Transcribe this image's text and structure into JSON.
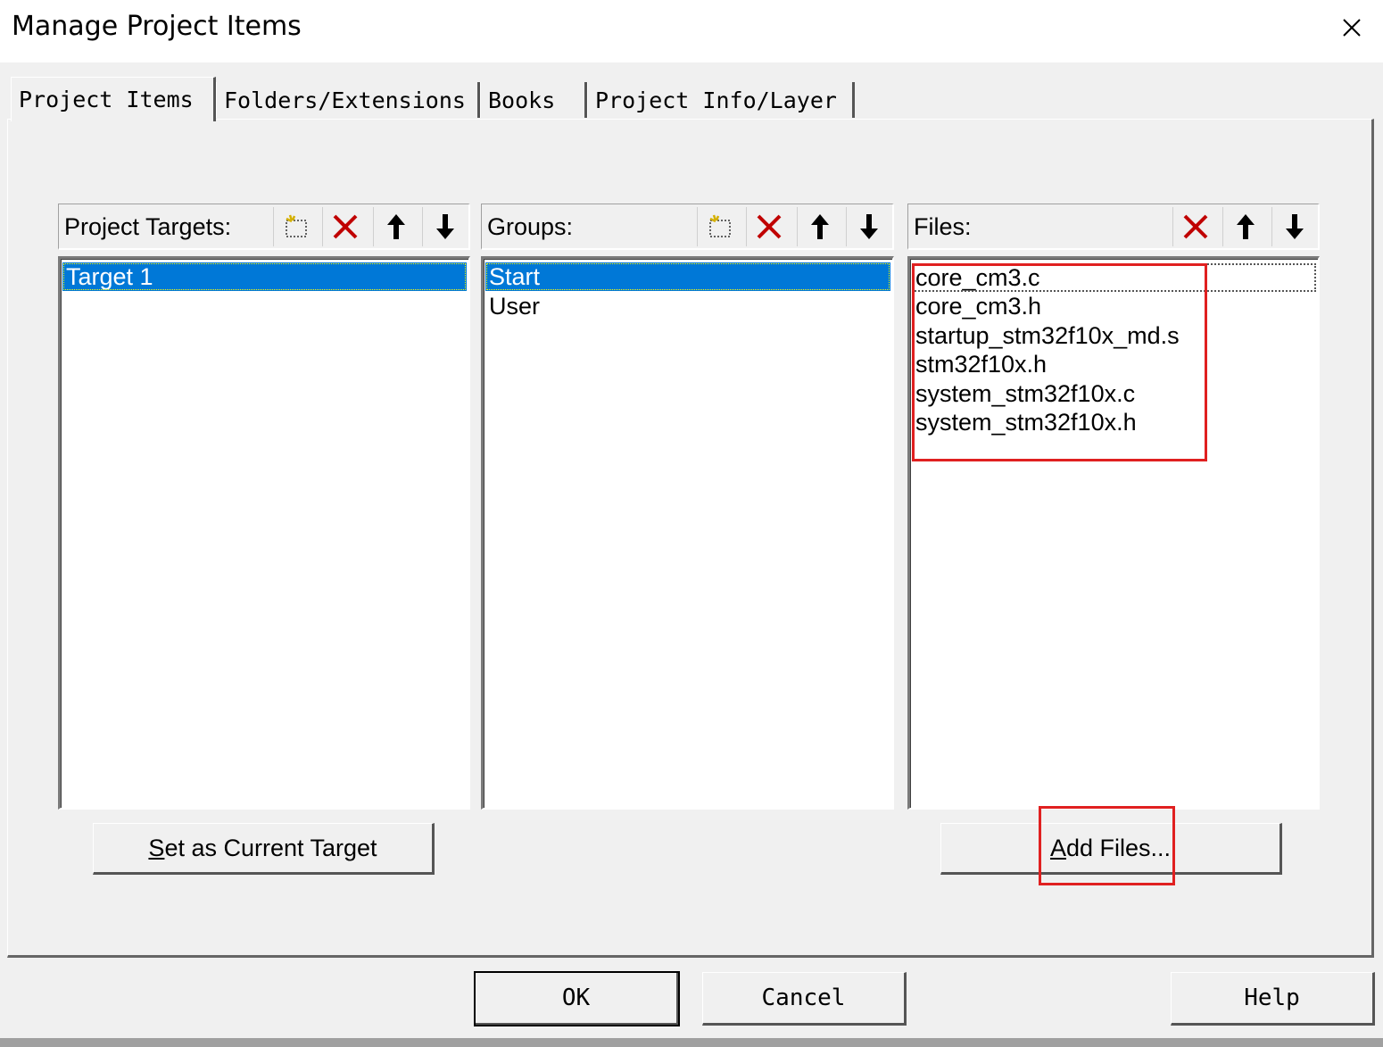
{
  "window": {
    "title": "Manage Project Items",
    "close_icon": "close-icon"
  },
  "tabs": [
    {
      "label": "Project Items"
    },
    {
      "label": "Folders/Extensions"
    },
    {
      "label": "Books"
    },
    {
      "label": "Project Info/Layer"
    }
  ],
  "targets": {
    "label": "Project Targets:",
    "items": [
      "Target 1"
    ],
    "set_current_pre": "",
    "set_current_accel": "S",
    "set_current_post": "et as Current Target"
  },
  "groups": {
    "label": "Groups:",
    "items": [
      "Start",
      "User"
    ]
  },
  "files": {
    "label": "Files:",
    "items": [
      "core_cm3.c",
      "core_cm3.h",
      "startup_stm32f10x_md.s",
      "stm32f10x.h",
      "system_stm32f10x.c",
      "system_stm32f10x.h"
    ],
    "add_accel": "A",
    "add_post": "dd Files..."
  },
  "footer": {
    "ok": "OK",
    "cancel": "Cancel",
    "help": "Help"
  },
  "colors": {
    "selection": "#0078d7",
    "annotation": "#e02020",
    "delete_icon": "#c00000"
  }
}
